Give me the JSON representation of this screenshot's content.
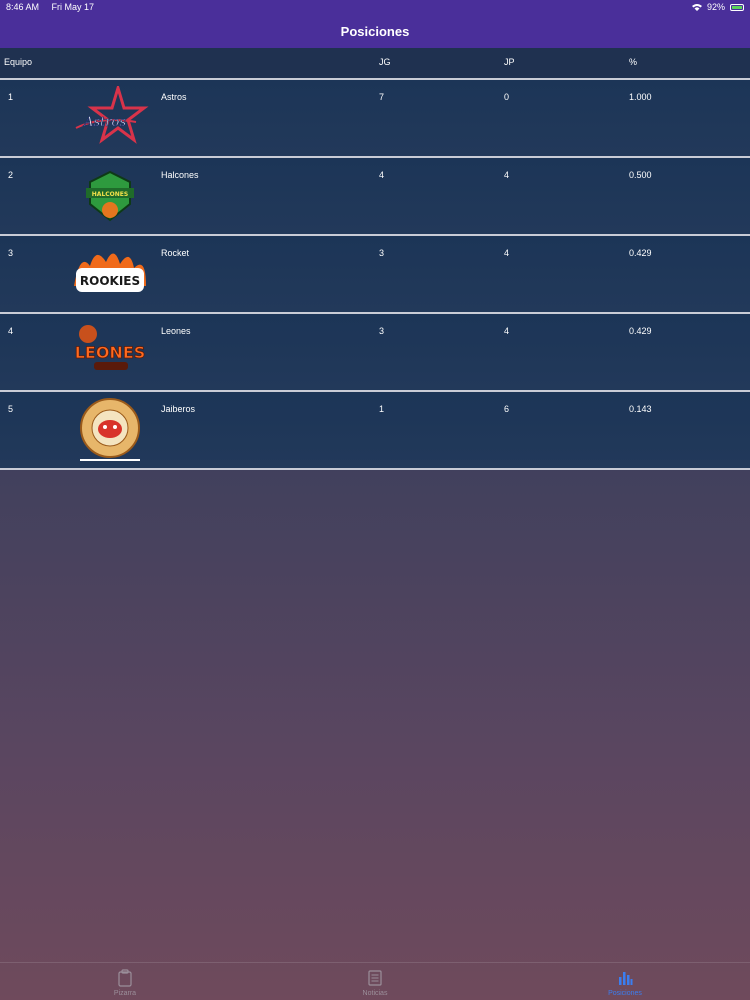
{
  "status_bar": {
    "time": "8:46 AM",
    "date": "Fri May 17",
    "battery": "92%"
  },
  "nav": {
    "title": "Posiciones"
  },
  "table": {
    "headers": {
      "team": "Equipo",
      "jg": "JG",
      "jp": "JP",
      "pct": "%"
    },
    "rows": [
      {
        "pos": "1",
        "team": "Astros",
        "jg": "7",
        "jp": "0",
        "pct": "1.000",
        "logo": "astros-logo",
        "logo_text": "Astros"
      },
      {
        "pos": "2",
        "team": "Halcones",
        "jg": "4",
        "jp": "4",
        "pct": "0.500",
        "logo": "halcones-logo",
        "logo_text": "HALCONES"
      },
      {
        "pos": "3",
        "team": "Rocket",
        "jg": "3",
        "jp": "4",
        "pct": "0.429",
        "logo": "rookies-logo",
        "logo_text": "ROOKIES"
      },
      {
        "pos": "4",
        "team": "Leones",
        "jg": "3",
        "jp": "4",
        "pct": "0.429",
        "logo": "leones-logo",
        "logo_text": "LEONES"
      },
      {
        "pos": "5",
        "team": "Jaiberos",
        "jg": "1",
        "jp": "6",
        "pct": "0.143",
        "logo": "jaiberos-logo",
        "logo_text": ""
      }
    ]
  },
  "tabs": [
    {
      "label": "Pizarra",
      "icon": "clipboard-icon",
      "active": false
    },
    {
      "label": "Noticias",
      "icon": "news-icon",
      "active": false
    },
    {
      "label": "Posiciones",
      "icon": "bar-chart-icon",
      "active": true
    }
  ],
  "colors": {
    "header_bg": "#4a2f9a",
    "row_bg": "#1c3557",
    "active_tab": "#3b7ef0"
  }
}
